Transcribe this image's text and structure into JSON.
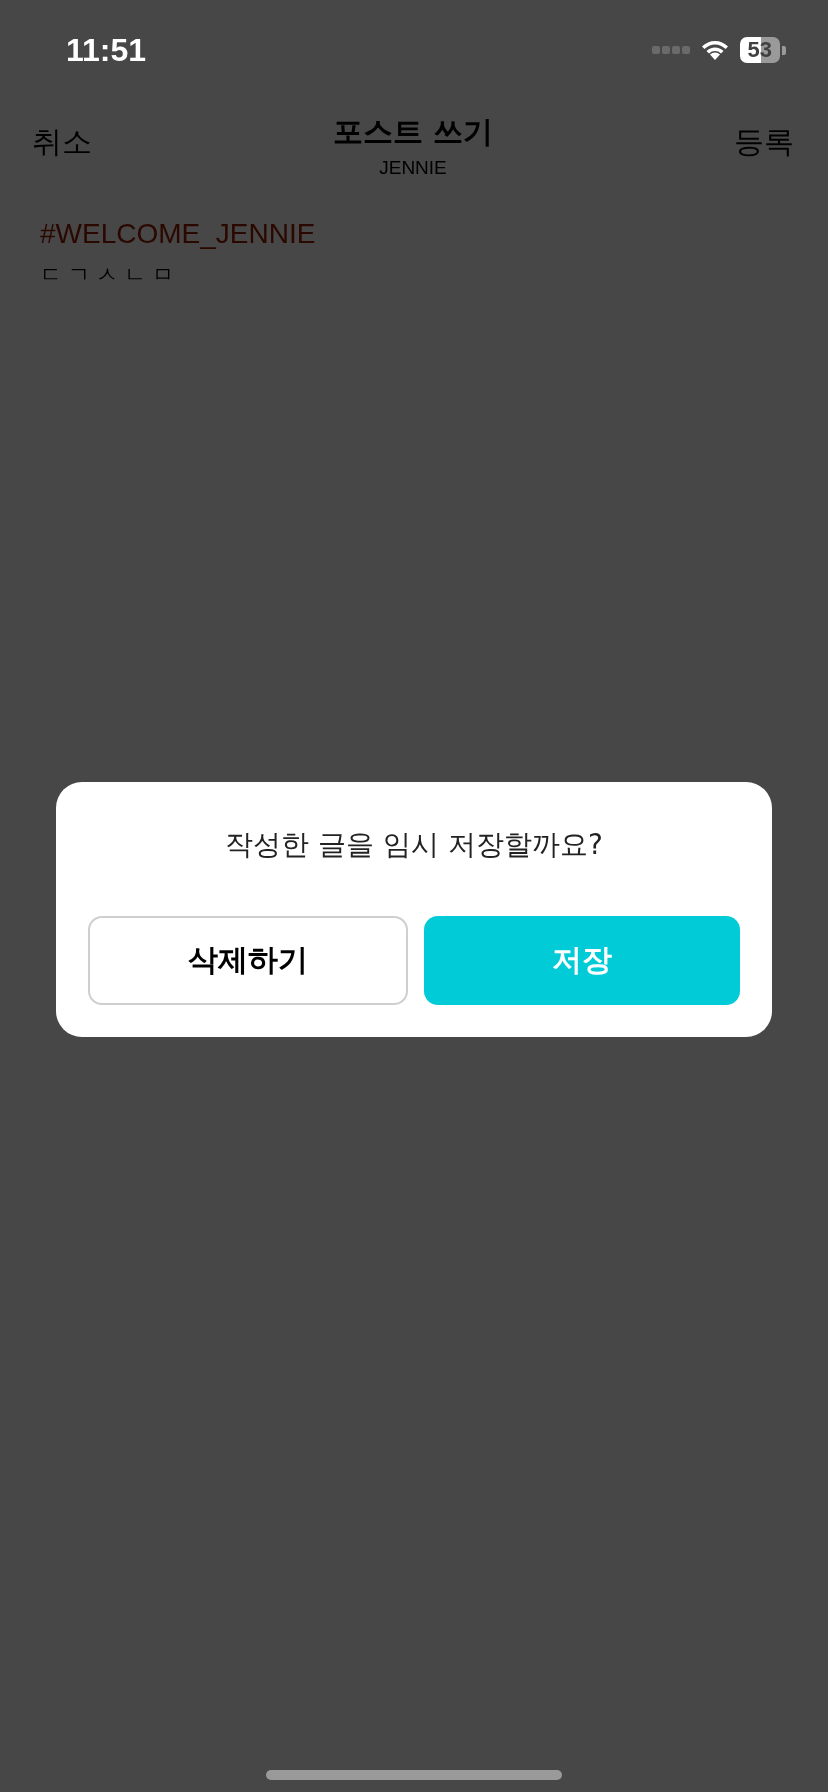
{
  "status_bar": {
    "time": "11:51",
    "battery": "53"
  },
  "nav": {
    "cancel": "취소",
    "title": "포스트 쓰기",
    "subtitle": "JENNIE",
    "submit": "등록"
  },
  "post": {
    "hashtag": "#WELCOME_JENNIE",
    "body": "ㄷㄱㅅㄴㅁ"
  },
  "dialog": {
    "message": "작성한 글을 임시 저장할까요?",
    "buttons": [
      {
        "label": "삭제하기",
        "kind": "secondary"
      },
      {
        "label": "저장",
        "kind": "primary"
      }
    ]
  }
}
